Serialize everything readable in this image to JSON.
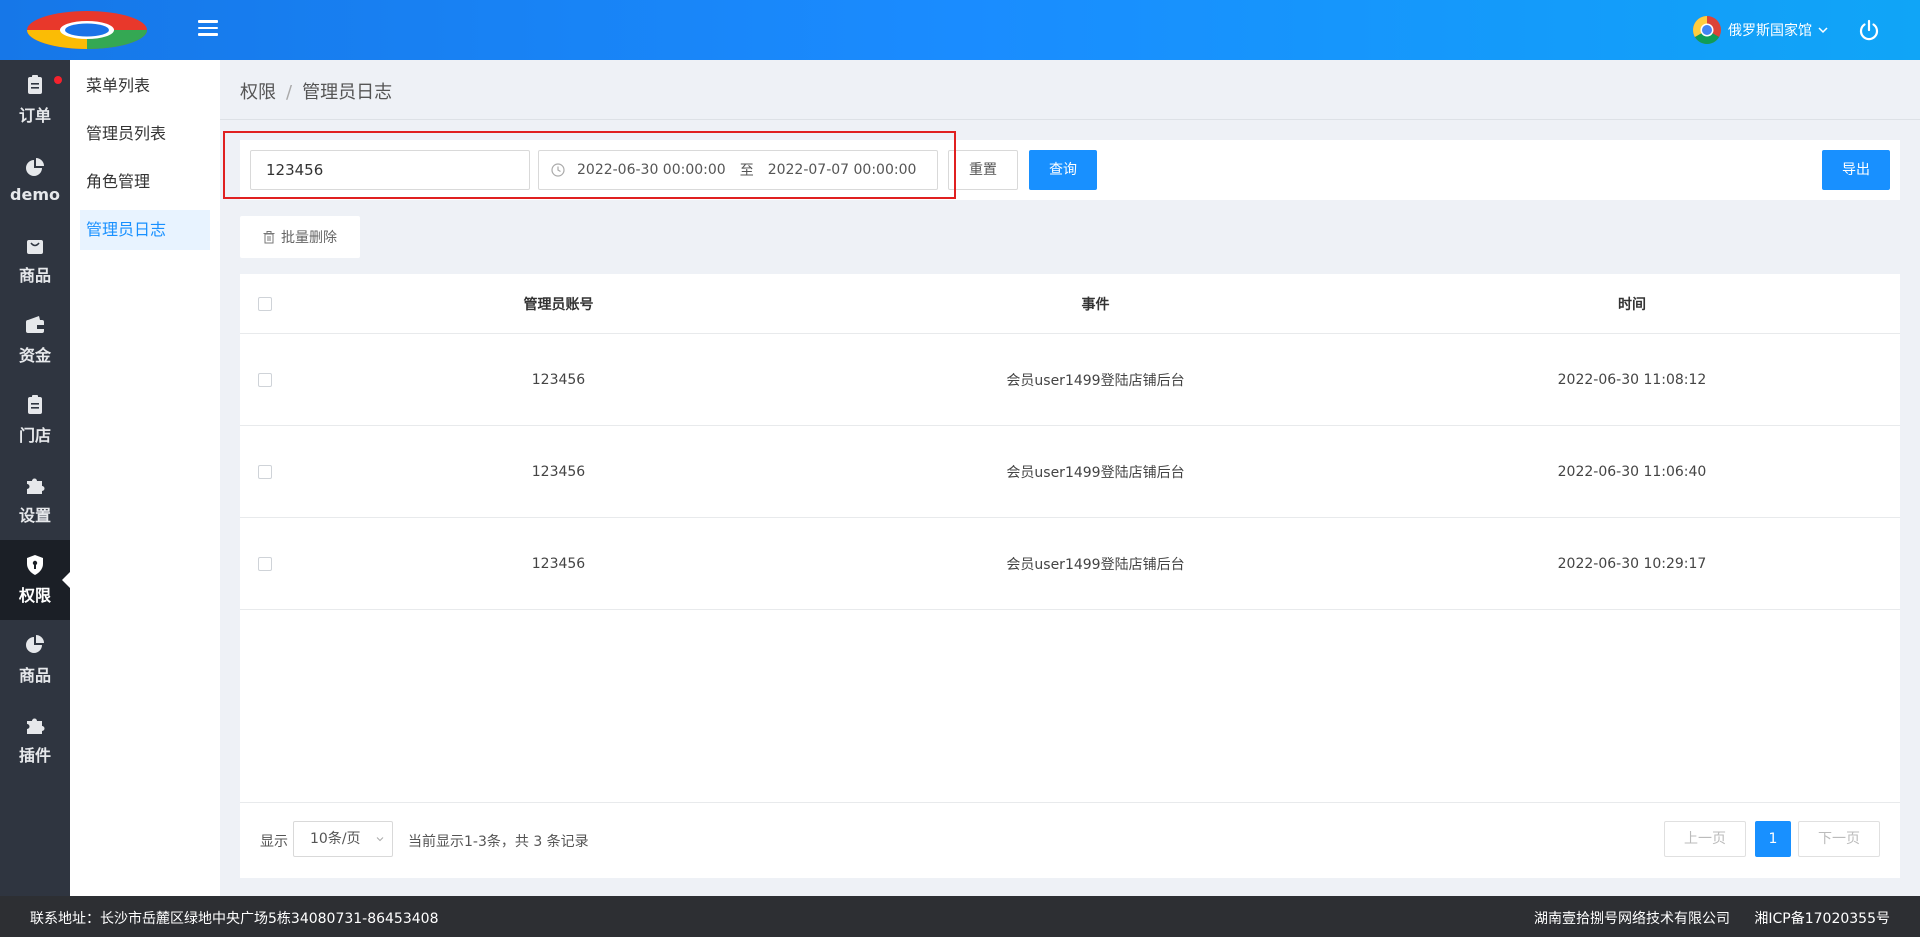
{
  "topbar": {
    "user_name": "俄罗斯国家馆"
  },
  "sidebar": {
    "items": [
      {
        "label": "订单",
        "icon": "clipboard-icon"
      },
      {
        "label": "demo",
        "icon": "pie-chart-icon"
      },
      {
        "label": "商品",
        "icon": "shopping-bag-icon"
      },
      {
        "label": "资金",
        "icon": "wallet-icon"
      },
      {
        "label": "门店",
        "icon": "clipboard-list-icon"
      },
      {
        "label": "设置",
        "icon": "puzzle-icon"
      },
      {
        "label": "权限",
        "icon": "shield-icon"
      },
      {
        "label": "商品",
        "icon": "pie-chart-icon"
      },
      {
        "label": "插件",
        "icon": "puzzle-icon"
      }
    ],
    "active": "权限"
  },
  "submenu": {
    "items": [
      "菜单列表",
      "管理员列表",
      "角色管理",
      "管理员日志"
    ],
    "active": "管理员日志"
  },
  "breadcrumb": {
    "root": "权限",
    "separator": "/",
    "current": "管理员日志"
  },
  "filter": {
    "account_value": "123456",
    "date_start": "2022-06-30 00:00:00",
    "date_separator": "至",
    "date_end": "2022-07-07 00:00:00",
    "reset_label": "重置",
    "query_label": "查询",
    "export_label": "导出"
  },
  "batch_delete_label": "批量删除",
  "table": {
    "headers": [
      "管理员账号",
      "事件",
      "时间"
    ],
    "rows": [
      {
        "account": "123456",
        "event": "会员user1499登陆店铺后台",
        "time": "2022-06-30 11:08:12"
      },
      {
        "account": "123456",
        "event": "会员user1499登陆店铺后台",
        "time": "2022-06-30 11:06:40"
      },
      {
        "account": "123456",
        "event": "会员user1499登陆店铺后台",
        "time": "2022-06-30 10:29:17"
      }
    ]
  },
  "pagination": {
    "show_label": "显示",
    "page_size": "10条/页",
    "info": "当前显示1-3条，共 3 条记录",
    "prev_label": "上一页",
    "current_page": "1",
    "next_label": "下一页"
  },
  "footer": {
    "address": "联系地址：长沙市岳麓区绿地中央广场5栋34080731-86453408",
    "company": "湖南壹拾捌号网络技术有限公司",
    "icp": "湘ICP备17020355号"
  },
  "colors": {
    "primary": "#1890ff",
    "sidebar_bg": "#2f3540",
    "footer_bg": "#2d2f33",
    "highlight_border": "#e02020",
    "notification_dot": "#f5222d"
  }
}
